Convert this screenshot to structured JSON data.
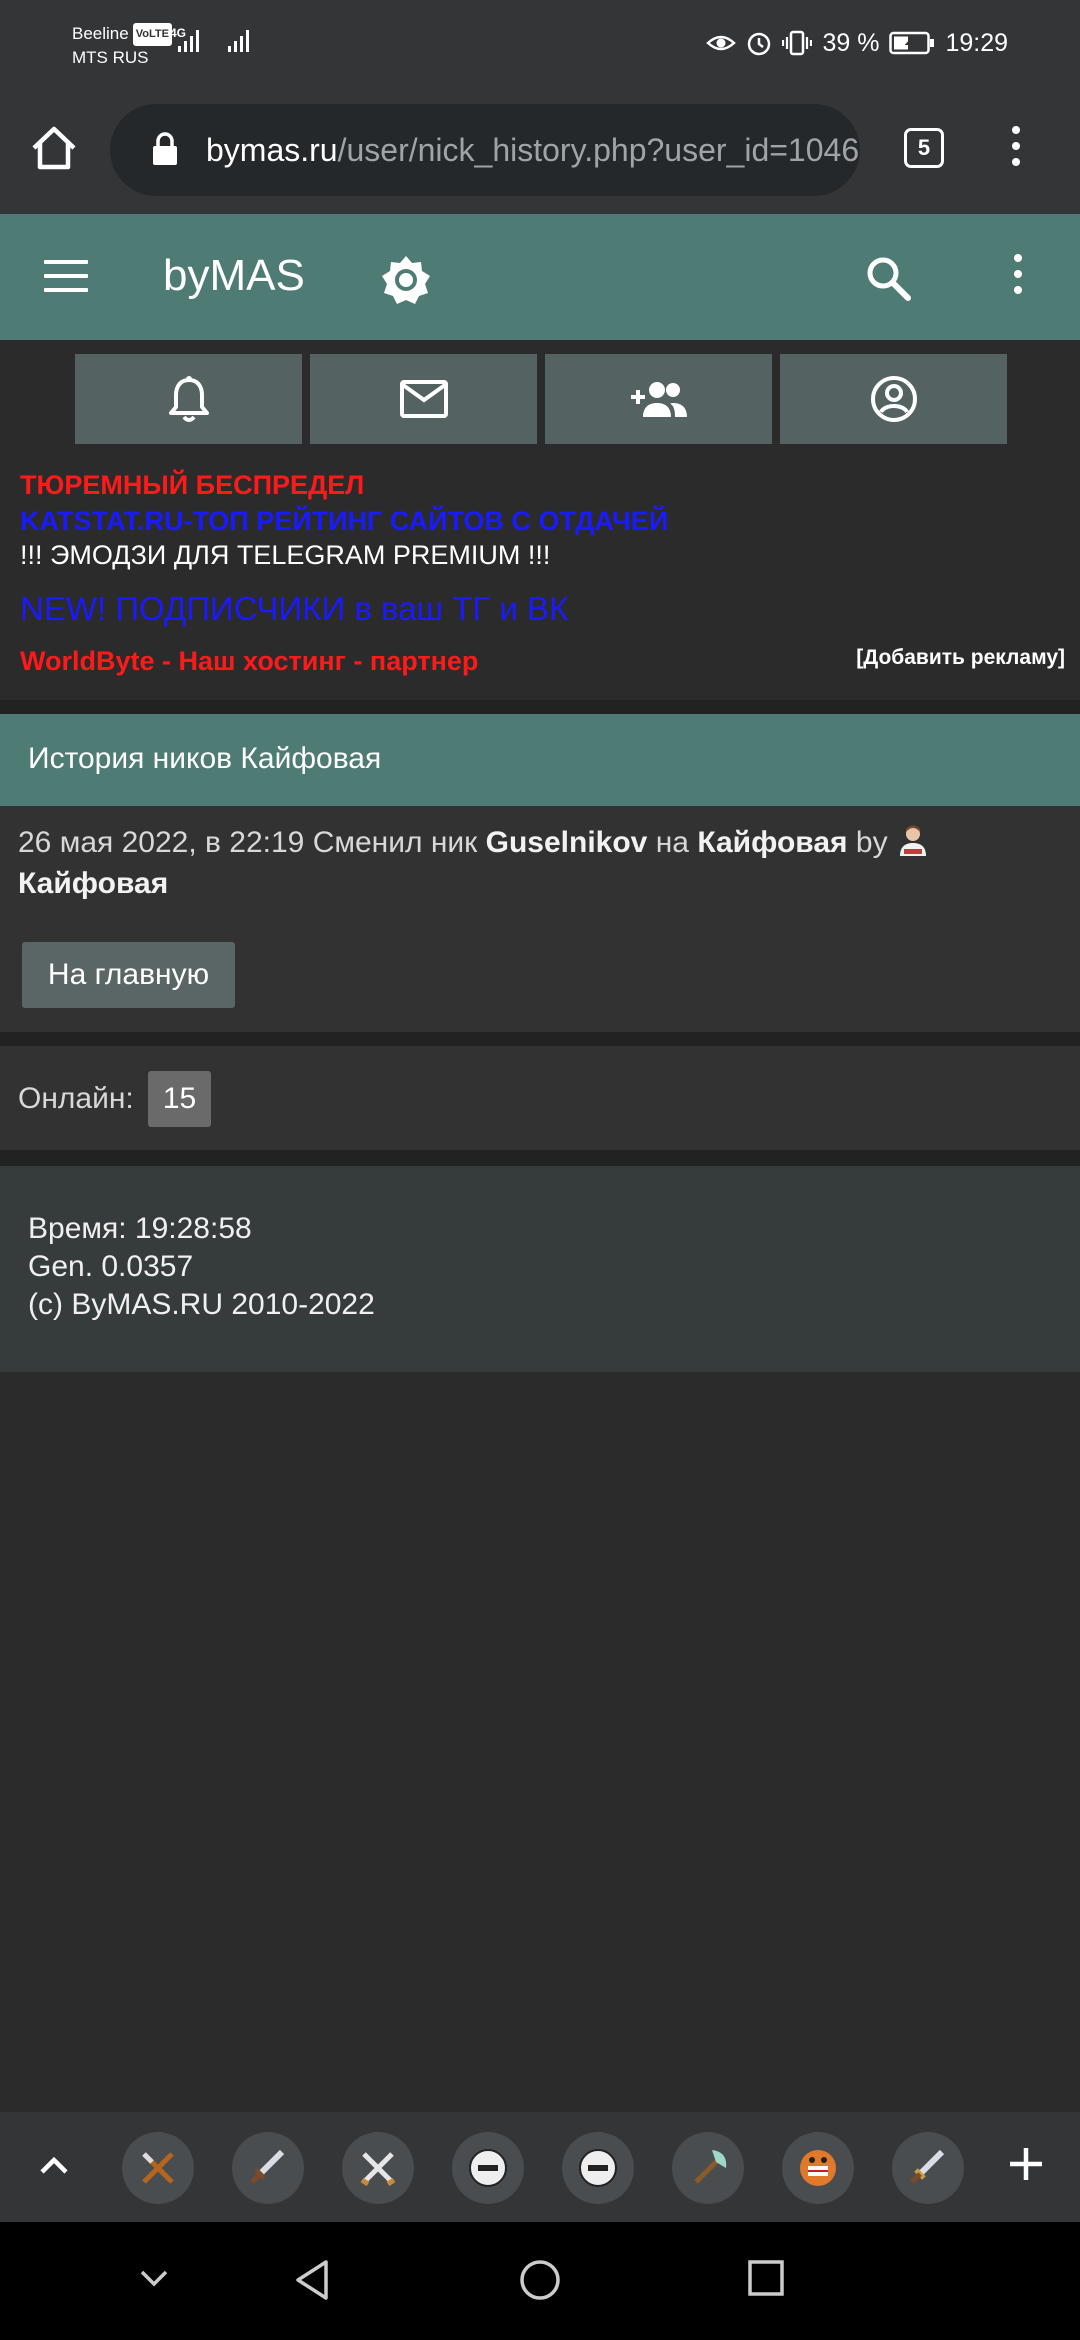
{
  "status_bar": {
    "carrier1": "Beeline",
    "volte": "VoLTE",
    "net": "4G",
    "carrier2": "MTS RUS",
    "battery": "39 %",
    "time": "19:29",
    "icons": [
      "eye-icon",
      "alarm-icon",
      "vibrate-icon",
      "battery-icon"
    ]
  },
  "browser": {
    "url_host": "bymas.ru",
    "url_path": "/user/nick_history.php?user_id=1046",
    "tab_count": "5",
    "icons": [
      "home-icon",
      "lock-icon",
      "menu-dots-icon"
    ]
  },
  "site": {
    "logo": "byMAS",
    "icons": [
      "hamburger-icon",
      "brightness-icon",
      "search-icon",
      "more-vert-icon"
    ],
    "accent": "#4f7b75"
  },
  "tiles": [
    "bell-icon",
    "mail-icon",
    "add-friend-icon",
    "account-icon"
  ],
  "ads": {
    "ad1": "ТЮРЕМНЫЙ БЕСПРЕДЕЛ",
    "ad2": "KATSTAT.RU-ТОП РЕЙТИНГ САЙТОВ С ОТДАЧЕЙ",
    "ad3": "!!! ЭМОДЗИ ДЛЯ TELEGRAM PREMIUM !!!",
    "ad4": "NEW! ПОДПИСЧИКИ в ваш ТГ и ВК",
    "ad5": "WorldByte - Наш хостинг - партнер",
    "add_ad": "[Добавить рекламу]"
  },
  "page": {
    "title": "История ников Кайфовая",
    "entry_date": "26 мая 2022, в 22:19",
    "entry_changed": "Сменил ник",
    "old_nick": "Guselnikov",
    "entry_to": "на",
    "new_nick": "Кайфовая",
    "entry_by": "by",
    "by_user": "Кайфовая",
    "home_button": "На главную"
  },
  "online": {
    "label": "Онлайн:",
    "count": "15"
  },
  "footer": {
    "time": "Время: 19:28:58",
    "gen": "Gen. 0.0357",
    "copyright": "(c) ByMAS.RU 2010-2022"
  },
  "bottom_bar": {
    "tab_icons": [
      "crossed-swords-icon",
      "sword-icon",
      "crossed-swords-icon",
      "helmet-icon",
      "helmet-icon",
      "axe-icon",
      "monster-icon",
      "sword-icon"
    ]
  }
}
